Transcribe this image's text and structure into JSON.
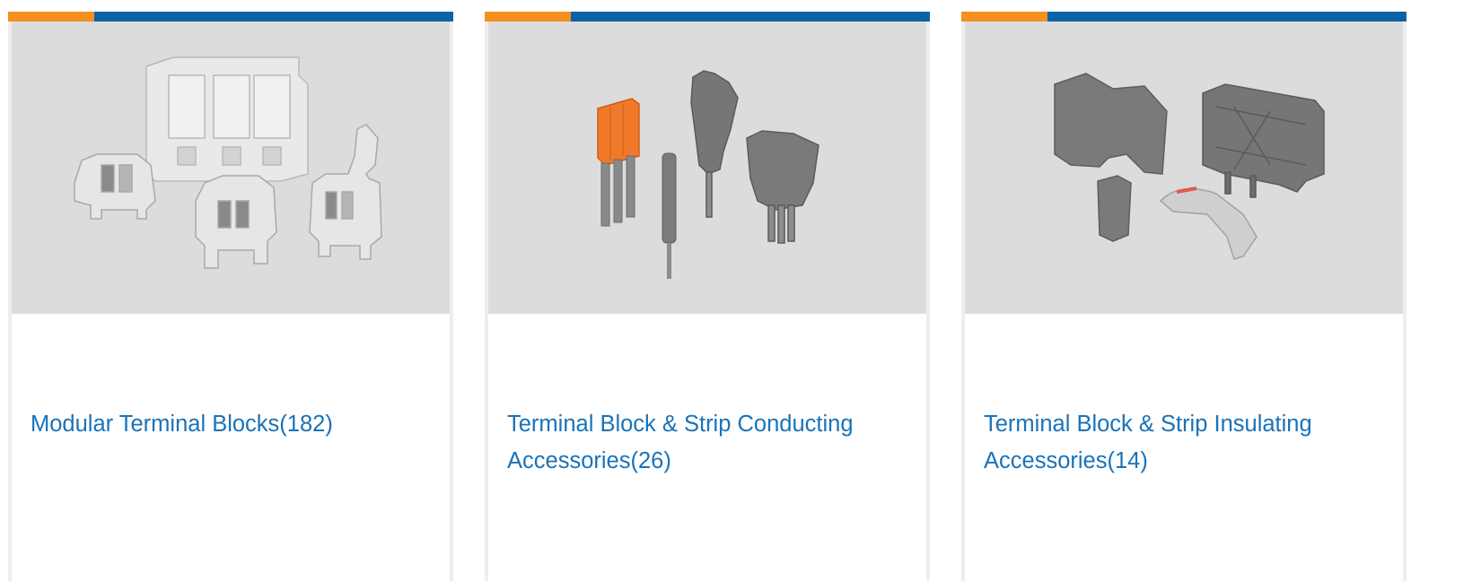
{
  "colors": {
    "accent_orange": "#f5901e",
    "brand_blue": "#0b63a5",
    "link_text": "#1a73b8",
    "image_bg": "#dcdcdc",
    "card_border": "#eeeeee"
  },
  "categories": [
    {
      "title": "Modular Terminal Blocks(182)",
      "image": "modular-terminal-blocks-image"
    },
    {
      "title": "Terminal Block & Strip Conducting Accessories(26)",
      "image": "conducting-accessories-image"
    },
    {
      "title": "Terminal Block & Strip Insulating Accessories(14)",
      "image": "insulating-accessories-image"
    }
  ]
}
